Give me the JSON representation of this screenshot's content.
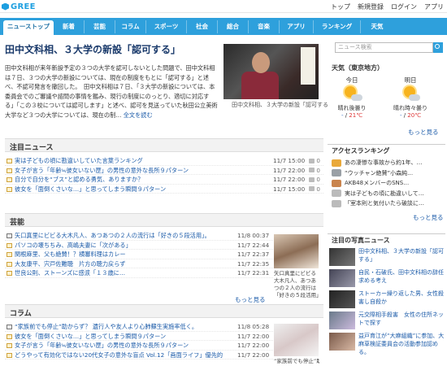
{
  "brand": {
    "name": "GREE",
    "color": "#1d9fe0"
  },
  "toplinks": [
    "トップ",
    "新規登録",
    "ログイン",
    "アプリ"
  ],
  "tabs": [
    {
      "label": "ニューストップ",
      "active": true
    },
    {
      "label": "新着"
    },
    {
      "label": "芸能"
    },
    {
      "label": "コラム"
    },
    {
      "label": "スポーツ"
    },
    {
      "label": "社会"
    },
    {
      "label": "総合"
    },
    {
      "label": "音楽"
    },
    {
      "label": "アプリ"
    },
    {
      "label": "ランキング"
    },
    {
      "label": "天気"
    }
  ],
  "headline": "田中文科相、３大学の新設「認可する」",
  "lead": "田中文科相が来年新設予定の３つの大学を認可しないとした問題で、田中文科相は７日、３つの大学の新設については、現在の制度をもとに「認可する」と述べ、不認可発言を撤回した。　田中文科相は７日、「３大学の新設については、本委員会でのご審議や諮問の事情を鑑み、現行の制度にのっとり、適切に対応する」「この３校については認可します」と述べ、認可を見送っていた秋田公立美術大学など３つの大学については、現在の制…",
  "lead_more": "全文を読む",
  "photo_caption": "田中文科相、３大学の新設「認可する",
  "sections": {
    "attention": {
      "title": "注目ニュース",
      "items": [
        {
          "title": "実は子どもの頃に勘違いしていた言葉ランキング",
          "date": "11/7 15:00",
          "comments": "0"
        },
        {
          "title": "女子が言う「年齢≒彼女いない歴」の男性の意外な長所９パターン",
          "date": "11/7 22:00",
          "comments": "0"
        },
        {
          "title": "自分で自分を“ブス”と認める勇気、ありますか？",
          "date": "11/7 22:00",
          "comments": "0"
        },
        {
          "title": "彼女を「面倒くさいな…」と思ってしまう瞬間９パターン",
          "date": "11/7 15:00",
          "comments": "0"
        }
      ]
    },
    "geino": {
      "title": "芸能",
      "items": [
        {
          "title": "矢口真里にビビる大木凡人、あつあつの２人の流行は「好きの５段活用」。",
          "date": "11/8 00:37"
        },
        {
          "title": "パソコの壊ちちみ、高嶋夫妻に「次がある」",
          "date": "11/7 22:44"
        },
        {
          "title": "関根麻里、父も絶賛！？横審料理はカレー",
          "date": "11/7 22:37"
        },
        {
          "title": "大友康平、宍戸佐難聴　片方の聴力戻らず",
          "date": "11/7 22:35"
        },
        {
          "title": "世良公則、ストーンズに感涙「１３歳に…",
          "date": "11/7 22:31"
        }
      ],
      "thumb_caption": "矢口真里にビビる大木凡人、あつあつの２人の流行は「好きの５段活用」",
      "more": "もっと見る"
    },
    "column": {
      "title": "コラム",
      "items": [
        {
          "title": "“家族前でも停止”助からず？ 遺行人や友人より心肺蘇生実施率低く。",
          "date": "11/8 05:28"
        },
        {
          "title": "彼女を「面倒くさいな…」と思ってしまう瞬間９パターン",
          "date": "11/7 22:00"
        },
        {
          "title": "女子が言う「年齢≒彼女いない歴」の男性の意外な長所９パターン",
          "date": "11/7 22:00"
        },
        {
          "title": "どうやって有効化ではない20代女子の意外な盲点 Vol.12「画面ライフ」優先的",
          "date": "11/7 22:00"
        }
      ],
      "thumb_caption": "“家族前でも停止”助"
    }
  },
  "search": {
    "placeholder": "ニュース検索"
  },
  "weather": {
    "title": "天気（東京地方）",
    "days": [
      {
        "label": "今日",
        "desc": "晴れ後曇り",
        "temp_lo": "-",
        "temp_hi": "21℃"
      },
      {
        "label": "明日",
        "desc": "晴れ時々曇り",
        "temp_lo": "-",
        "temp_hi": "20℃"
      }
    ],
    "more": "もっと見る"
  },
  "access_ranking": {
    "title": "アクセスランキング",
    "items": [
      {
        "title": "あの凄惨な事故から約1年、…",
        "color": "#e9a93b"
      },
      {
        "title": "“ウッチャン絶賛”小森純…",
        "color": "#9aa0a6"
      },
      {
        "title": "AKB48メンバーのSNS…",
        "color": "#c9844d"
      },
      {
        "title": "実は子どもの頃に勘違いして…",
        "color": "#bbbbbb"
      },
      {
        "title": "「室本則と気付いたら破談に…",
        "color": "#bbbbbb"
      }
    ],
    "more": "もっと見る"
  },
  "photo_news": {
    "title": "注目の写真ニュース",
    "items": [
      "田中文科相、３大学の新設「認可する」",
      "自民・石破氏、田中文科相の辞任求める考え",
      "ストーカー繰り返した男、女性殺害し自殺か",
      "元交際相手殺害　女性の住所ネットで探す",
      "益戸育江が“大麻組織”に参加、大麻草検証委員会の活動参加認める。"
    ],
    "more": "もっと見る"
  }
}
